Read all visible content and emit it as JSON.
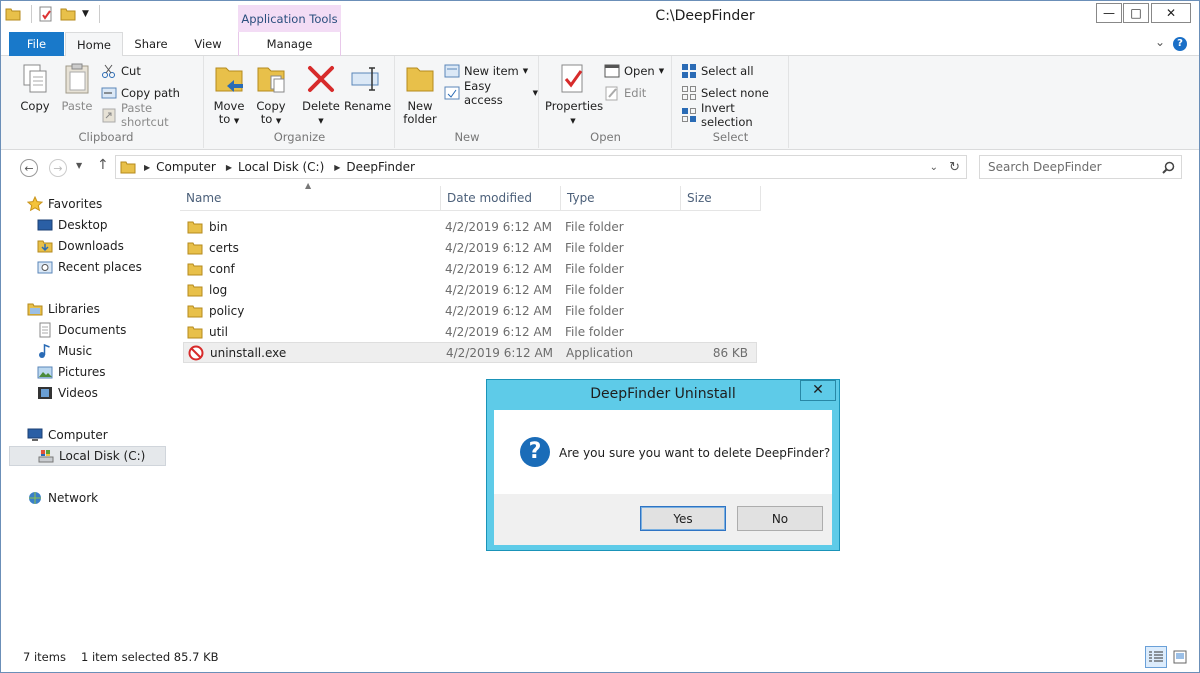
{
  "window": {
    "title": "C:\\DeepFinder",
    "contextual_tab_group": "Application Tools",
    "controls": {
      "minimize": "—",
      "maximize": "□",
      "close": "✕"
    }
  },
  "tabs": [
    "File",
    "Home",
    "Share",
    "View",
    "Manage"
  ],
  "ribbon": {
    "clipboard": {
      "label": "Clipboard",
      "copy": "Copy",
      "paste": "Paste",
      "cut": "Cut",
      "copy_path": "Copy path",
      "paste_shortcut": "Paste shortcut"
    },
    "organize": {
      "label": "Organize",
      "move_to_1": "Move",
      "move_to_2": "to",
      "copy_to_1": "Copy",
      "copy_to_2": "to",
      "delete": "Delete",
      "rename": "Rename"
    },
    "new": {
      "label": "New",
      "new_folder_1": "New",
      "new_folder_2": "folder",
      "new_item": "New item",
      "easy_access": "Easy access"
    },
    "open": {
      "label": "Open",
      "properties": "Properties",
      "open": "Open",
      "edit": "Edit"
    },
    "select": {
      "label": "Select",
      "select_all": "Select all",
      "select_none": "Select none",
      "invert": "Invert selection"
    }
  },
  "address": {
    "crumbs": [
      "Computer",
      "Local Disk (C:)",
      "DeepFinder"
    ],
    "search_placeholder": "Search DeepFinder"
  },
  "sidebar": {
    "favorites": "Favorites",
    "fav_items": [
      "Desktop",
      "Downloads",
      "Recent places"
    ],
    "libraries": "Libraries",
    "lib_items": [
      "Documents",
      "Music",
      "Pictures",
      "Videos"
    ],
    "computer": "Computer",
    "computer_items": [
      "Local Disk (C:)"
    ],
    "network": "Network"
  },
  "columns": [
    "Name",
    "Date modified",
    "Type",
    "Size"
  ],
  "files": [
    {
      "name": "bin",
      "date": "4/2/2019 6:12 AM",
      "type": "File folder",
      "size": ""
    },
    {
      "name": "certs",
      "date": "4/2/2019 6:12 AM",
      "type": "File folder",
      "size": ""
    },
    {
      "name": "conf",
      "date": "4/2/2019 6:12 AM",
      "type": "File folder",
      "size": ""
    },
    {
      "name": "log",
      "date": "4/2/2019 6:12 AM",
      "type": "File folder",
      "size": ""
    },
    {
      "name": "policy",
      "date": "4/2/2019 6:12 AM",
      "type": "File folder",
      "size": ""
    },
    {
      "name": "util",
      "date": "4/2/2019 6:12 AM",
      "type": "File folder",
      "size": ""
    },
    {
      "name": "uninstall.exe",
      "date": "4/2/2019 6:12 AM",
      "type": "Application",
      "size": "86 KB"
    }
  ],
  "status": {
    "count": "7 items",
    "selection": "1 item selected  85.7 KB"
  },
  "dialog": {
    "title": "DeepFinder Uninstall",
    "close": "✕",
    "message": "Are you sure you want to delete DeepFinder?",
    "icon": "?",
    "yes": "Yes",
    "no": "No"
  },
  "colors": {
    "file_tab": "#1979ca",
    "dialog_frame": "#5ecbe8",
    "context_tab": "#f3dcf5",
    "folder": "#e8c04a"
  }
}
